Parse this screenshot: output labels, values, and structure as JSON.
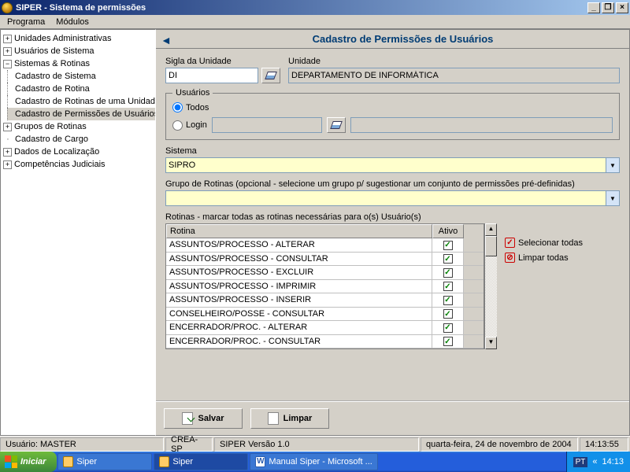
{
  "window": {
    "title": "SIPER - Sistema de permissões"
  },
  "menu": {
    "programa": "Programa",
    "modulos": "Módulos"
  },
  "tree": {
    "n0": "Unidades Administrativas",
    "n1": "Usuários de Sistema",
    "n2": "Sistemas & Rotinas",
    "n2a": "Cadastro de Sistema",
    "n2b": "Cadastro de Rotina",
    "n2c": "Cadastro de Rotinas de uma Unidade",
    "n2d": "Cadastro de Permissões de Usuários",
    "n3": "Grupos de Rotinas",
    "n4": "Cadastro de Cargo",
    "n5": "Dados de Localização",
    "n6": "Competências Judiciais"
  },
  "page": {
    "title": "Cadastro de Permissões de Usuários",
    "sigla_label": "Sigla da Unidade",
    "sigla_value": "DI",
    "unidade_label": "Unidade",
    "unidade_value": "DEPARTAMENTO DE INFORMÁTICA",
    "usuarios_legend": "Usuários",
    "radio_todos": "Todos",
    "radio_login": "Login",
    "sistema_label": "Sistema",
    "sistema_value": "SIPRO",
    "grupo_label": "Grupo de Rotinas (opcional - selecione um grupo p/ sugestionar um conjunto de permissões pré-definidas)",
    "grupo_value": "",
    "rotinas_label": "Rotinas - marcar todas as rotinas necessárias para o(s) Usuário(s)",
    "col_rotina": "Rotina",
    "col_ativo": "Ativo",
    "rows": [
      "ASSUNTOS/PROCESSO - ALTERAR",
      "ASSUNTOS/PROCESSO - CONSULTAR",
      "ASSUNTOS/PROCESSO - EXCLUIR",
      "ASSUNTOS/PROCESSO - IMPRIMIR",
      "ASSUNTOS/PROCESSO - INSERIR",
      "CONSELHEIRO/POSSE - CONSULTAR",
      "ENCERRADOR/PROC. - ALTERAR",
      "ENCERRADOR/PROC. - CONSULTAR"
    ],
    "sel_todas": "Selecionar todas",
    "limpar_todas": "Limpar todas",
    "btn_salvar": "Salvar",
    "btn_limpar": "Limpar"
  },
  "status": {
    "user": "Usuário:  MASTER",
    "org": "CREA-SP",
    "ver": "SIPER Versão 1.0",
    "date": "quarta-feira, 24 de novembro de 2004",
    "time": "14:13:55"
  },
  "taskbar": {
    "start": "Iniciar",
    "t1": "Siper",
    "t2": "Siper",
    "t3": "Manual Siper - Microsoft ...",
    "lang": "PT",
    "clock": "14:13"
  }
}
